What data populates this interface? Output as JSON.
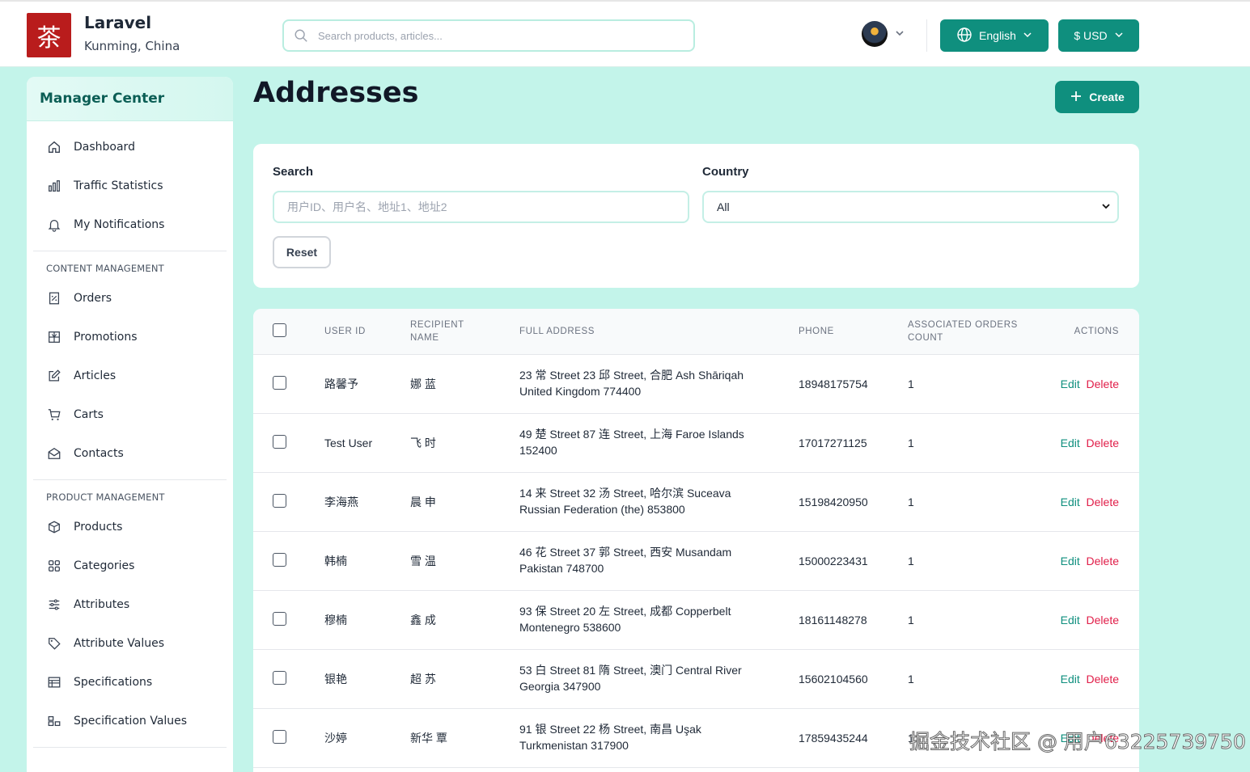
{
  "header": {
    "logo_glyph": "茶",
    "brand_name": "Laravel",
    "location": "Kunming, China",
    "search_placeholder": "Search products, articles...",
    "language": "English",
    "currency": "$ USD"
  },
  "sidebar": {
    "title": "Manager Center",
    "top_items": [
      {
        "label": "Dashboard",
        "icon": "home-icon"
      },
      {
        "label": "Traffic Statistics",
        "icon": "bar-chart-icon"
      },
      {
        "label": "My Notifications",
        "icon": "bell-icon"
      }
    ],
    "sections": [
      {
        "title": "CONTENT MANAGEMENT",
        "items": [
          {
            "label": "Orders",
            "icon": "receipt-icon"
          },
          {
            "label": "Promotions",
            "icon": "gift-icon"
          },
          {
            "label": "Articles",
            "icon": "edit-icon"
          },
          {
            "label": "Carts",
            "icon": "cart-icon"
          },
          {
            "label": "Contacts",
            "icon": "mail-icon"
          }
        ]
      },
      {
        "title": "PRODUCT MANAGEMENT",
        "items": [
          {
            "label": "Products",
            "icon": "box-icon"
          },
          {
            "label": "Categories",
            "icon": "grid-icon"
          },
          {
            "label": "Attributes",
            "icon": "sliders-icon"
          },
          {
            "label": "Attribute Values",
            "icon": "tag-icon"
          },
          {
            "label": "Specifications",
            "icon": "table-icon"
          },
          {
            "label": "Specification Values",
            "icon": "spec-values-icon"
          }
        ]
      }
    ]
  },
  "page": {
    "title": "Addresses",
    "create_label": "Create"
  },
  "filters": {
    "search_label": "Search",
    "search_placeholder": "用户ID、用户名、地址1、地址2",
    "country_label": "Country",
    "country_value": "All",
    "reset_label": "Reset"
  },
  "table": {
    "columns": {
      "user_id": "USER ID",
      "recipient_1": "RECIPIENT",
      "recipient_2": "NAME",
      "address": "FULL ADDRESS",
      "phone": "PHONE",
      "orders_1": "ASSOCIATED ORDERS",
      "orders_2": "COUNT",
      "actions": "ACTIONS"
    },
    "edit_label": "Edit",
    "delete_label": "Delete",
    "rows": [
      {
        "user": "路馨予",
        "recipient": "娜 蓝",
        "address_1": "23 常 Street 23 邱 Street, 合肥 Ash Shāriqah",
        "address_2": "United Kingdom 774400",
        "phone": "18948175754",
        "count": "1"
      },
      {
        "user": "Test User",
        "recipient": "飞 时",
        "address_1": "49 楚 Street 87 连 Street, 上海 Faroe Islands",
        "address_2": "152400",
        "phone": "17017271125",
        "count": "1"
      },
      {
        "user": "李海燕",
        "recipient": "晨 申",
        "address_1": "14 来 Street 32 汤 Street, 哈尔滨 Suceava",
        "address_2": "Russian Federation (the) 853800",
        "phone": "15198420950",
        "count": "1"
      },
      {
        "user": "韩楠",
        "recipient": "雪 温",
        "address_1": "46 花 Street 37 郭 Street, 西安 Musandam",
        "address_2": "Pakistan 748700",
        "phone": "15000223431",
        "count": "1"
      },
      {
        "user": "穆楠",
        "recipient": "鑫 成",
        "address_1": "93 保 Street 20 左 Street, 成都 Copperbelt",
        "address_2": "Montenegro 538600",
        "phone": "18161148278",
        "count": "1"
      },
      {
        "user": "银艳",
        "recipient": "超 苏",
        "address_1": "53 白 Street 81 隋 Street, 澳门 Central River",
        "address_2": "Georgia 347900",
        "phone": "15602104560",
        "count": "1"
      },
      {
        "user": "沙婷",
        "recipient": "新华 覃",
        "address_1": "91 银 Street 22 杨 Street, 南昌 Uşak",
        "address_2": "Turkmenistan 317900",
        "phone": "17859435244",
        "count": "1"
      }
    ]
  },
  "watermark": "掘金技术社区 @ 用户63225739750",
  "colors": {
    "accent": "#0f8f7e",
    "danger": "#e11d48",
    "background": "#c3f4ea",
    "logo": "#b91c1c"
  }
}
